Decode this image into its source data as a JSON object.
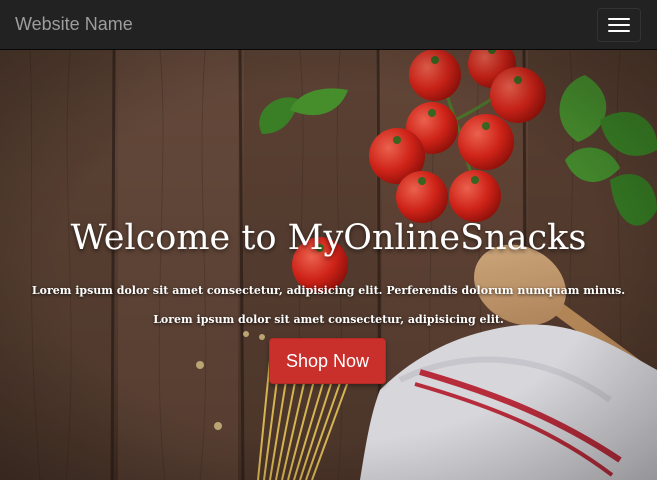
{
  "navbar": {
    "brand": "Website Name",
    "menu_icon": "hamburger-menu-icon"
  },
  "hero": {
    "title": "Welcome to MyOnlineSnacks",
    "text_line1": "Lorem ipsum dolor sit amet consectetur, adipisicing elit. Perferendis dolorum numquam minus.",
    "text_line2": "Lorem ipsum dolor sit amet consectetur, adipisicing elit.",
    "button_label": "Shop Now"
  },
  "colors": {
    "navbar_bg": "#222222",
    "brand_text": "#9d9d9d",
    "button_bg": "#c9302c",
    "wood": "#5a4032"
  }
}
